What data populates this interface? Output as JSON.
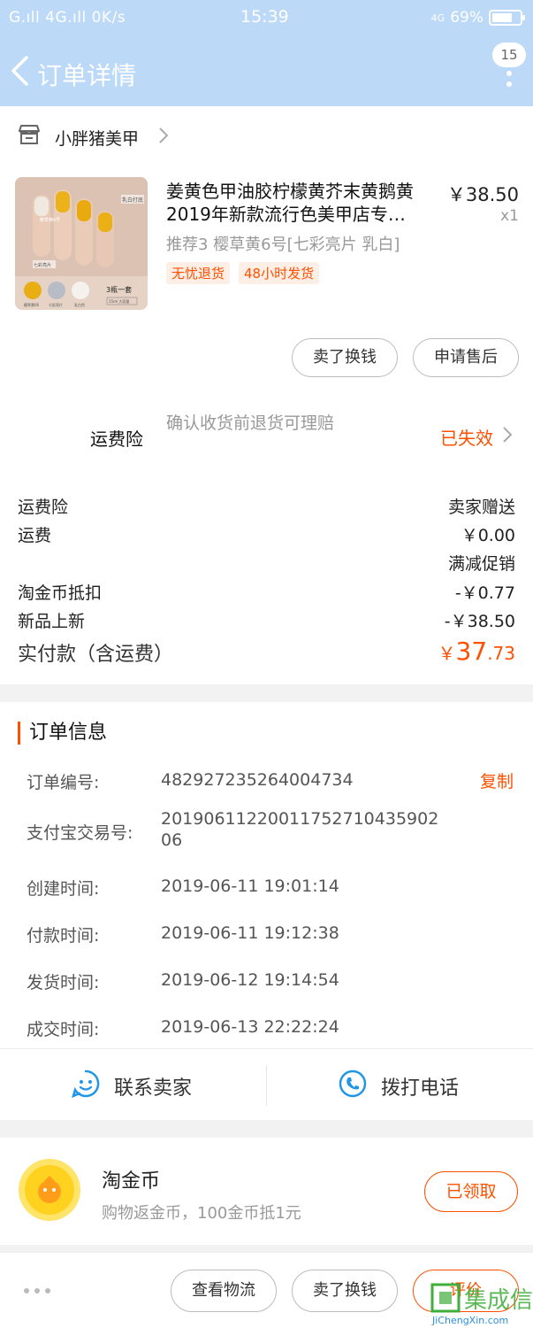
{
  "status_bar": {
    "left": "G.ıll 4G.ıll 0K/s",
    "time": "15:39",
    "network": "4G",
    "battery": "69%"
  },
  "header": {
    "title": "订单详情",
    "badge": "15"
  },
  "shop": {
    "name": "小胖猪美甲"
  },
  "product": {
    "title": "姜黄色甲油胶柠檬黄芥末黄鹅黄2019年新款流行色美甲店专…",
    "price": "￥38.50",
    "qty": "x1",
    "sku": "推荐3 樱草黄6号[七彩亮片 乳白]",
    "tags": [
      "无忧退货",
      "48小时发货"
    ],
    "image_text": {
      "top_label": "乳白打底",
      "mid_label": "樱草黄6号",
      "side_label": "七彩亮片",
      "swatch1": "樱草黄06",
      "swatch2": "七彩亮片",
      "swatch3": "乳白色",
      "set_label": "3瓶一套",
      "volume": "15ml 大容量"
    }
  },
  "actions": {
    "sell_btn": "卖了换钱",
    "after_sale_btn": "申请售后"
  },
  "insurance": {
    "label": "运费险",
    "desc": "确认收货前退货可理赔",
    "status": "已失效"
  },
  "fees": [
    {
      "label": "运费险",
      "value": "卖家赠送"
    },
    {
      "label": "运费",
      "value": "￥0.00"
    },
    {
      "label": "",
      "value": "满减促销"
    },
    {
      "label": "淘金币抵扣",
      "value": "-￥0.77"
    },
    {
      "label": "新品上新",
      "value": "-￥38.50"
    }
  ],
  "total": {
    "label": "实付款（含运费）",
    "symbol": "￥",
    "integer": "37",
    "decimal": ".73"
  },
  "order_info": {
    "title": "订单信息",
    "copy": "复制",
    "rows": [
      {
        "key": "订单编号:",
        "value": "482927235264004734"
      },
      {
        "key": "支付宝交易号:",
        "value": "20190611220011752710435902 06"
      },
      {
        "key": "创建时间:",
        "value": "2019-06-11 19:01:14"
      },
      {
        "key": "付款时间:",
        "value": "2019-06-11 19:12:38"
      },
      {
        "key": "发货时间:",
        "value": "2019-06-12 19:14:54"
      },
      {
        "key": "成交时间:",
        "value": "2019-06-13 22:22:24"
      }
    ]
  },
  "contact": {
    "seller": "联系卖家",
    "call": "拨打电话"
  },
  "coins": {
    "title": "淘金币",
    "desc": "购物返金币，100金币抵1元",
    "button": "已领取"
  },
  "bottom": {
    "logistics": "查看物流",
    "sell": "卖了换钱",
    "review": "评价"
  },
  "watermark": {
    "cn": "集成信",
    "en": "JiChengXin.com"
  },
  "colors": {
    "header_bg": "#bcd9f7",
    "accent": "#ff5000",
    "contact_icon": "#2196e6"
  }
}
